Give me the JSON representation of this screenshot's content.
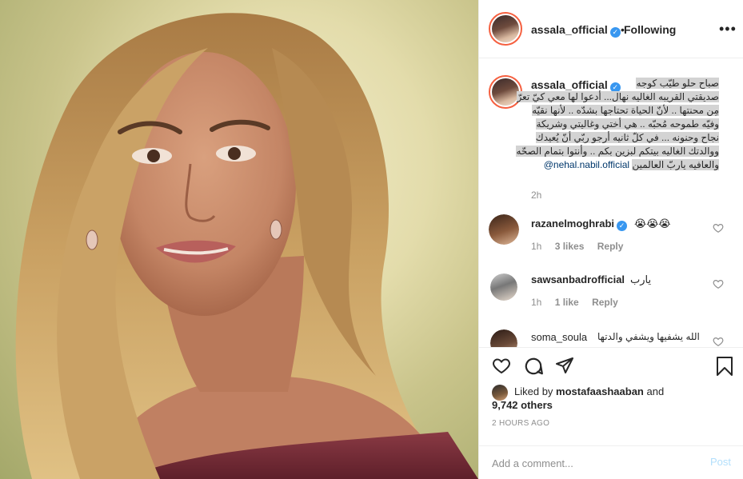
{
  "post": {
    "username": "assala_official",
    "separator": "•",
    "follow_status": "Following",
    "more_label": "•••"
  },
  "caption": {
    "username": "assala_official",
    "lines": [
      "صباح حلو طيّب كوجه",
      "صديقتي القريبه الغاليه نهال... أدعوا لها معي كيّ تعرّ",
      "مِن محنتها .. لأنّ الحياة تحتاجها بشدّه .. لأنها نقيّه",
      "وفيّه طموحه مُحبّه .. هي أختي وغاليتي وشريكة",
      "نجاح وحنونه ... في كلّ ثانيه أرجو ربّي أنّ يُعيدك",
      "ووالدتك الغاليه بيتكم لبزين بكم .. وأنتوا بتمام الصحّه"
    ],
    "last_line": "والعافيه ياربّ العالمين",
    "mention": "@nehal.nabil.official",
    "time": "2h"
  },
  "comments": [
    {
      "username": "razanelmoghrabi",
      "text": "😭😭😭",
      "time": "1h",
      "likes": "3 likes",
      "reply": "Reply"
    },
    {
      "username": "sawsanbadrofficial",
      "text": "يارب",
      "time": "1h",
      "likes": "1 like",
      "reply": "Reply"
    },
    {
      "username": "soma_soula",
      "text": "الله يشفيها ويشفي والدتها",
      "time": "",
      "likes": "",
      "reply": ""
    }
  ],
  "likes": {
    "prefix": "Liked by",
    "user": "mostafaashaaban",
    "and": "and",
    "others": "9,742 others"
  },
  "timestamp": "2 HOURS AGO",
  "add_comment": {
    "placeholder": "Add a comment...",
    "post_label": "Post"
  },
  "colors": {
    "accent": "#3897f0",
    "post_disabled": "#b2dffc",
    "border": "#efefef",
    "secondary_text": "#8e8e8e"
  }
}
